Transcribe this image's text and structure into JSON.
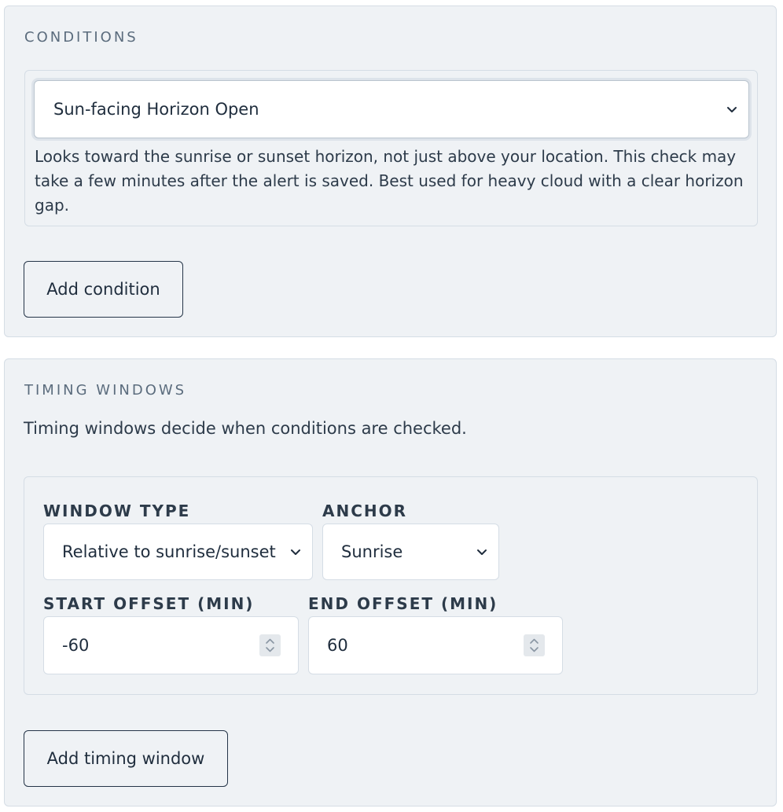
{
  "conditions": {
    "title": "CONDITIONS",
    "selected_condition": "Sun-facing Horizon Open",
    "help_text": "Looks toward the sunrise or sunset horizon, not just above your location. This check may take a few minutes after the alert is saved. Best used for heavy cloud with a clear horizon gap.",
    "add_button_label": "Add condition"
  },
  "timing": {
    "title": "TIMING WINDOWS",
    "intro": "Timing windows decide when conditions are checked.",
    "window_type_label": "WINDOW TYPE",
    "window_type_value": "Relative to sunrise/sunset",
    "anchor_label": "ANCHOR",
    "anchor_value": "Sunrise",
    "start_offset_label": "START OFFSET (MIN)",
    "start_offset_value": "-60",
    "end_offset_label": "END OFFSET (MIN)",
    "end_offset_value": "60",
    "add_button_label": "Add timing window"
  },
  "icons": {
    "select": "chevron-down-icon",
    "number": "spinner-icon"
  },
  "colors": {
    "panel_bg": "#eff2f5",
    "border": "#d5dde5",
    "text": "#1f2d3d",
    "muted_title": "#5b6c7d"
  }
}
